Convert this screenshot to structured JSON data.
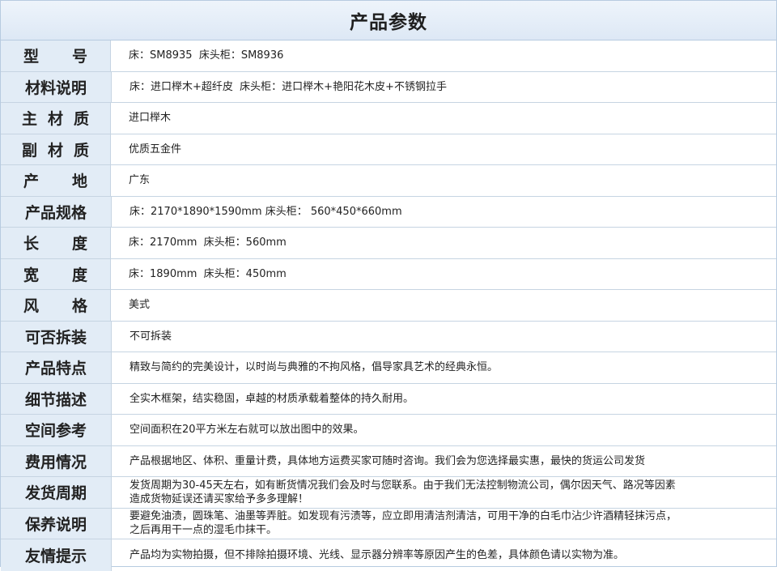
{
  "title": "产品参数",
  "rows": [
    {
      "label_chars": [
        "型",
        "号"
      ],
      "value": "床：SM8935  床头柜：SM8936"
    },
    {
      "label": "材料说明",
      "value": "床：进口榉木+超纤皮  床头柜：进口榉木+艳阳花木皮+不锈钢拉手"
    },
    {
      "label_chars": [
        "主",
        "材",
        "质"
      ],
      "value": "进口榉木"
    },
    {
      "label_chars": [
        "副",
        "材",
        "质"
      ],
      "value": "优质五金件"
    },
    {
      "label_chars": [
        "产",
        "地"
      ],
      "value": "广东"
    },
    {
      "label": "产品规格",
      "value": "床：2170*1890*1590mm 床头柜： 560*450*660mm"
    },
    {
      "label_chars": [
        "长",
        "度"
      ],
      "value": "床：2170mm  床头柜：560mm"
    },
    {
      "label_chars": [
        "宽",
        "度"
      ],
      "value": "床：1890mm  床头柜：450mm"
    },
    {
      "label_chars": [
        "风",
        "格"
      ],
      "value": "美式"
    },
    {
      "label": "可否拆装",
      "value": "不可拆装"
    },
    {
      "label": "产品特点",
      "value": "精致与简约的完美设计，以时尚与典雅的不拘风格，倡导家具艺术的经典永恒。"
    },
    {
      "label": "细节描述",
      "value": "全实木框架，结实稳固，卓越的材质承载着整体的持久耐用。"
    },
    {
      "label": "空间参考",
      "value": "空间面积在20平方米左右就可以放出图中的效果。"
    },
    {
      "label": "费用情况",
      "value": "产品根据地区、体积、重量计费，具体地方运费买家可随时咨询。我们会为您选择最实惠，最快的货运公司发货"
    },
    {
      "label": "发货周期",
      "value": "发货周期为30-45天左右，如有断货情况我们会及时与您联系。由于我们无法控制物流公司，偶尔因天气、路况等因素\n造成货物延误还请买家给予多多理解！"
    },
    {
      "label": "保养说明",
      "value": "要避免油渍，圆珠笔、油墨等弄脏。如发现有污渍等，应立即用清洁剂清洁，可用干净的白毛巾沾少许酒精轻抹污点，\n之后再用干一点的湿毛巾抹干。"
    },
    {
      "label": "友情提示",
      "value": "产品均为实物拍摄，但不排除拍摄环境、光线、显示器分辨率等原因产生的色差，具体颜色请以实物为准。"
    }
  ]
}
